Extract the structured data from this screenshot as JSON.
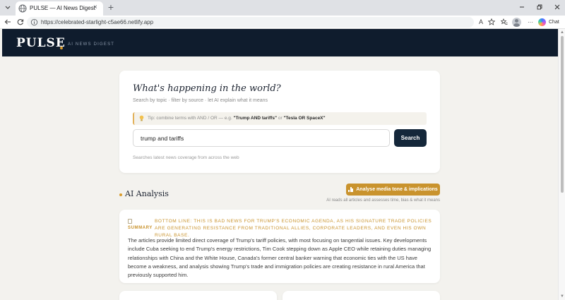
{
  "browser": {
    "tab_title": "PULSE — AI News Digest",
    "close_glyph": "×",
    "new_tab_glyph": "+",
    "url": "https://celebrated-starlight-c5ae66.netlify.app",
    "read_aloud_label": "A",
    "chat_label": "Chat",
    "more_glyph": "···"
  },
  "header": {
    "brand": "PULSE",
    "tagline": "AI NEWS DIGEST"
  },
  "search": {
    "title": "What's happening in the world?",
    "subtitle": "Search by topic · filter by source · let AI explain what it means",
    "tip_prefix": "Tip: combine terms with AND / OR — e.g. ",
    "tip_example_1": "\"Trump AND tariffs\"",
    "tip_or": " or ",
    "tip_example_2": "\"Tesla OR SpaceX\"",
    "query": "trump and tariffs",
    "button_label": "Search",
    "hint": "Searches latest news coverage from across the web"
  },
  "analysis": {
    "section_title": "AI Analysis",
    "analyse_button": "Analyse media tone & implications",
    "analyse_note": "AI reads all articles and assesses time, bias & what it means",
    "summary_label": "SUMMARY",
    "bottom_line": "BOTTOM LINE: THIS IS BAD NEWS FOR TRUMP'S ECONOMIC AGENDA, AS HIS SIGNATURE TRADE POLICIES ARE GENERATING RESISTANCE FROM TRADITIONAL ALLIES, CORPORATE LEADERS, AND EVEN HIS OWN RURAL BASE.",
    "summary_text": "The articles provide limited direct coverage of Trump's tariff policies, with most focusing on tangential issues. Key developments include Cuba seeking to end Trump's energy restrictions, Tim Cook stepping down as Apple CEO while retaining duties managing relationships with China and the White House, Canada's former central banker warning that economic ties with the US have become a weakness, and analysis showing Trump's trade and immigration policies are creating resistance in rural America that previously supported him."
  },
  "colors": {
    "header_bg": "#0f1c2d",
    "accent_gold": "#c9932d",
    "search_button": "#14273a",
    "page_bg": "#f3f2ee"
  }
}
